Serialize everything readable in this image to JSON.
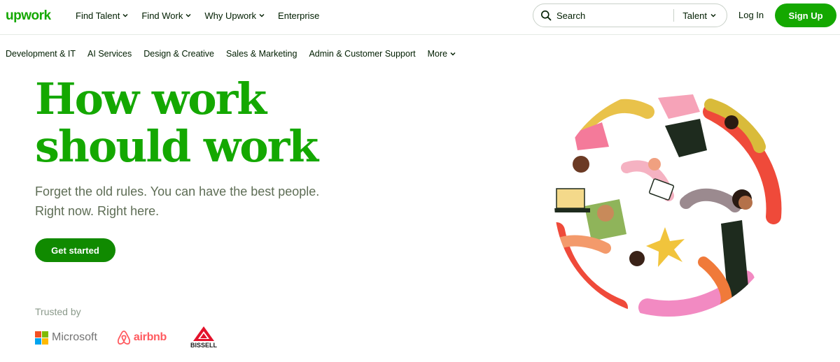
{
  "brand": {
    "logo_text": "upwork",
    "color": "#14a800"
  },
  "nav": {
    "items": [
      {
        "label": "Find Talent",
        "has_dropdown": true
      },
      {
        "label": "Find Work",
        "has_dropdown": true
      },
      {
        "label": "Why Upwork",
        "has_dropdown": true
      },
      {
        "label": "Enterprise",
        "has_dropdown": false
      }
    ]
  },
  "search": {
    "placeholder": "Search",
    "scope": "Talent",
    "icon": "search-icon"
  },
  "auth": {
    "login": "Log In",
    "signup": "Sign Up"
  },
  "categories": [
    {
      "label": "Development & IT"
    },
    {
      "label": "AI Services"
    },
    {
      "label": "Design & Creative"
    },
    {
      "label": "Sales & Marketing"
    },
    {
      "label": "Admin & Customer Support"
    },
    {
      "label": "More",
      "has_dropdown": true
    }
  ],
  "hero": {
    "headline_line1": "How work",
    "headline_line2": "should work",
    "subtitle_line1": "Forget the old rules. You can have the best people.",
    "subtitle_line2": "Right now. Right here.",
    "cta": "Get started"
  },
  "trusted": {
    "label": "Trusted by",
    "logos": [
      {
        "name": "Microsoft",
        "text": "Microsoft"
      },
      {
        "name": "airbnb",
        "text": "airbnb"
      },
      {
        "name": "Bissell",
        "text": "BISSELL"
      }
    ]
  },
  "colors": {
    "accent": "#14a800",
    "cta": "#108a00",
    "text": "#001e00",
    "muted": "#5e6d55"
  }
}
